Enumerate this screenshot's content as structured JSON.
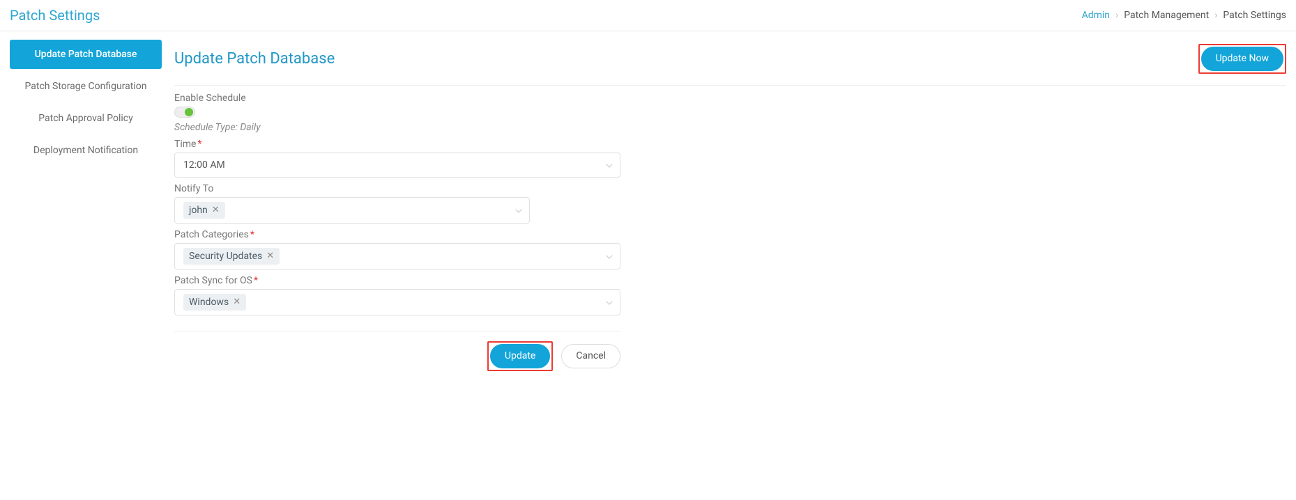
{
  "header": {
    "page_title": "Patch Settings",
    "breadcrumbs": {
      "admin": "Admin",
      "pm": "Patch Management",
      "ps": "Patch Settings"
    }
  },
  "sidebar": {
    "items": [
      "Update Patch Database",
      "Patch Storage Configuration",
      "Patch Approval Policy",
      "Deployment Notification"
    ]
  },
  "main": {
    "section_title": "Update Patch Database",
    "update_now_label": "Update Now",
    "enable_schedule_label": "Enable Schedule",
    "schedule_type_prefix": "Schedule Type: ",
    "schedule_type_value": "Daily",
    "time_label": "Time",
    "time_value": "12:00 AM",
    "notify_label": "Notify To",
    "notify_tags": [
      "john"
    ],
    "patch_cat_label": "Patch Categories",
    "patch_cat_tags": [
      "Security Updates"
    ],
    "patch_sync_label": "Patch Sync for OS",
    "patch_sync_tags": [
      "Windows"
    ],
    "update_btn": "Update",
    "cancel_btn": "Cancel"
  },
  "colors": {
    "primary": "#13a5d9",
    "accent_text": "#2ea6d1",
    "highlight": "#ec3b33",
    "toggle_on": "#67c23a"
  }
}
